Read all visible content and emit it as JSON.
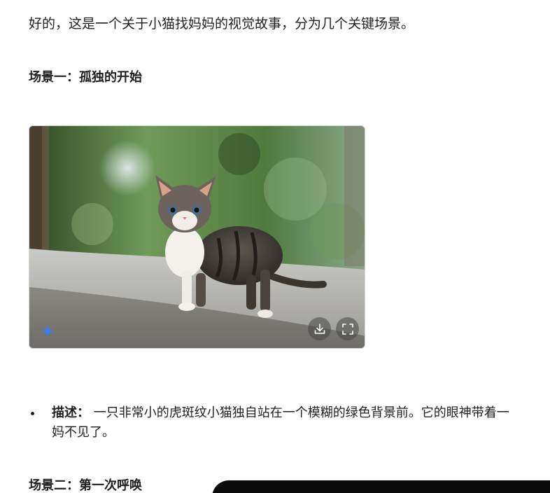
{
  "intro_text": "好的，这是一个关于小猫找妈妈的视觉故事，分为几个关键场景。",
  "scenes": [
    {
      "heading": "场景一：孤独的开始",
      "bullet_label": "描述：",
      "bullet_text_line1": " 一只非常小的虎斑纹小猫独自站在一个模糊的绿色背景前。它的眼神带着一",
      "bullet_text_line2": "妈不见了。"
    },
    {
      "heading": "场景二：第一次呼唤"
    }
  ],
  "image": {
    "alt": "kitten standing on a path",
    "buttons": {
      "download_icon": "download-icon",
      "fullscreen_icon": "fullscreen-icon"
    },
    "badge_icon": "sparkle-icon",
    "badge_color": "#3d7bfd"
  }
}
